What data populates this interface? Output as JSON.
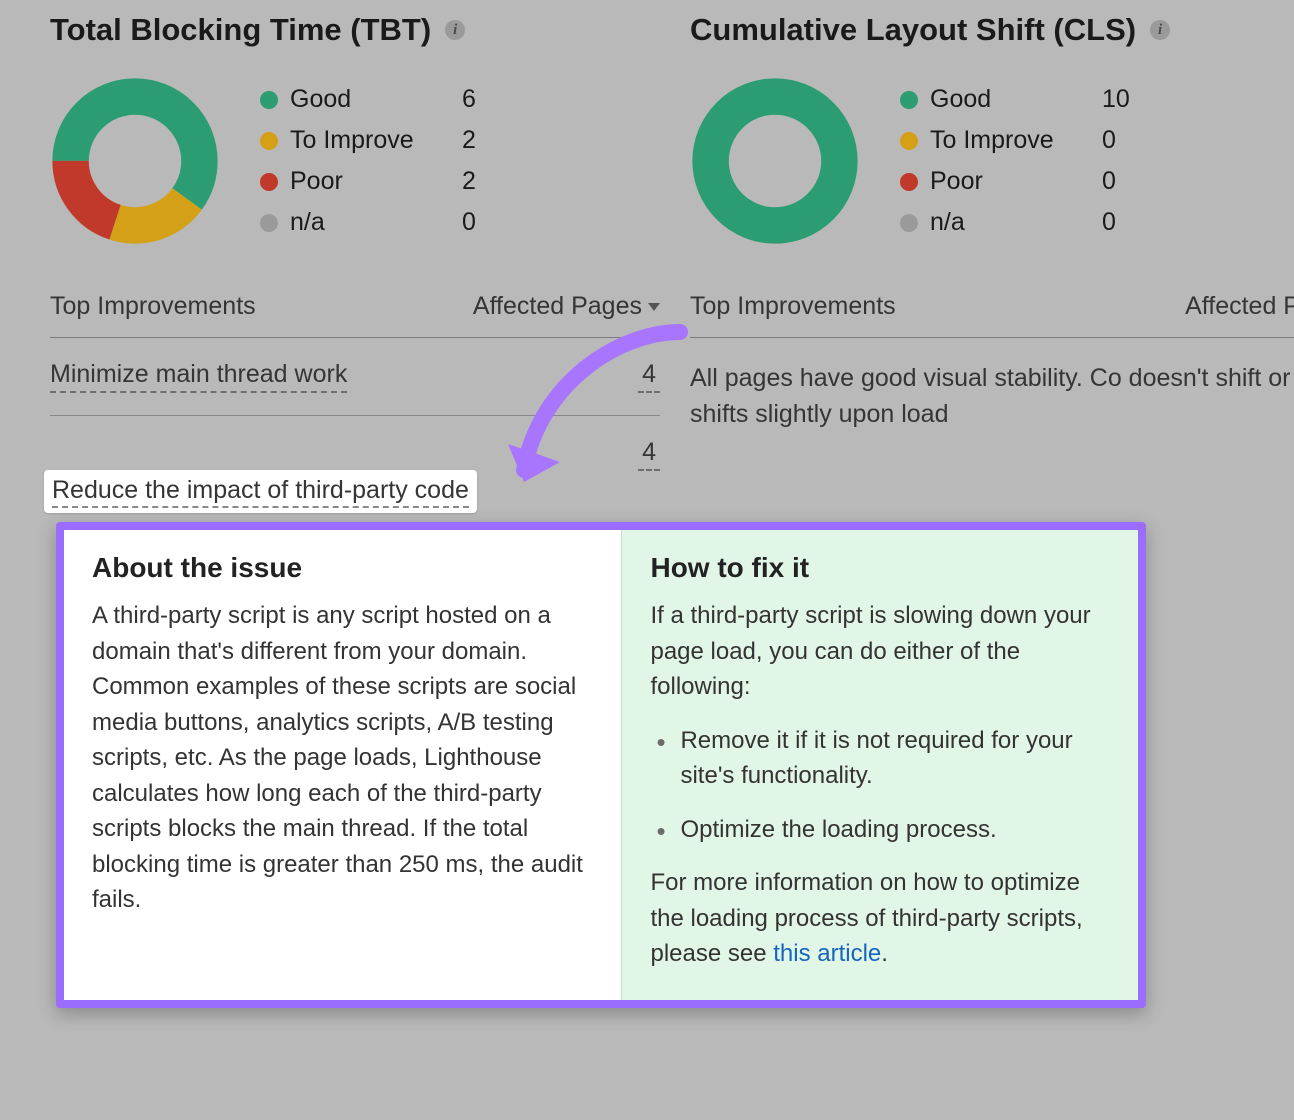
{
  "colors": {
    "good": "#2c9c72",
    "improve": "#d4a017",
    "poor": "#c0392b",
    "na": "#9a9a9a",
    "accent": "#9b6dff",
    "link": "#1565c0",
    "fix_bg": "#e2f6e7"
  },
  "metrics": {
    "tbt": {
      "title": "Total Blocking Time (TBT)",
      "legend": [
        {
          "label": "Good",
          "value": 6,
          "color": "good"
        },
        {
          "label": "To Improve",
          "value": 2,
          "color": "improve"
        },
        {
          "label": "Poor",
          "value": 2,
          "color": "poor"
        },
        {
          "label": "n/a",
          "value": 0,
          "color": "na"
        }
      ],
      "improvements": {
        "header": {
          "label": "Top Improvements",
          "count_label": "Affected Pages"
        },
        "rows": [
          {
            "label": "Minimize main thread work",
            "count": 4
          },
          {
            "label": "Reduce the impact of third-party code",
            "count": 4
          }
        ]
      }
    },
    "cls": {
      "title": "Cumulative Layout Shift (CLS)",
      "legend": [
        {
          "label": "Good",
          "value": 10,
          "color": "good"
        },
        {
          "label": "To Improve",
          "value": 0,
          "color": "improve"
        },
        {
          "label": "Poor",
          "value": 0,
          "color": "poor"
        },
        {
          "label": "n/a",
          "value": 0,
          "color": "na"
        }
      ],
      "improvements": {
        "header": {
          "label": "Top Improvements",
          "count_label": "Affected P"
        },
        "good_text": "All pages have good visual stability. Co doesn't shift or shifts slightly upon load"
      }
    }
  },
  "callout": {
    "about": {
      "heading": "About the issue",
      "body": "A third-party script is any script hosted on a domain that's different from your domain. Common examples of these scripts are social media buttons, analytics scripts, A/B testing scripts, etc. As the page loads, Lighthouse calculates how long each of the third-party scripts blocks the main thread. If the total blocking time is greater than 250 ms, the audit fails."
    },
    "fix": {
      "heading": "How to fix it",
      "intro": "If a third-party script is slowing down your page load, you can do either of the following:",
      "bullets": [
        "Remove it if it is not required for your site's functionality.",
        "Optimize the loading process."
      ],
      "more_prefix": "For more information on how to optimize the loading process of third-party scripts, please see ",
      "link_text": "this article",
      "more_suffix": "."
    }
  },
  "chart_data": [
    {
      "type": "pie",
      "title": "Total Blocking Time (TBT)",
      "categories": [
        "Good",
        "To Improve",
        "Poor",
        "n/a"
      ],
      "values": [
        6,
        2,
        2,
        0
      ]
    },
    {
      "type": "pie",
      "title": "Cumulative Layout Shift (CLS)",
      "categories": [
        "Good",
        "To Improve",
        "Poor",
        "n/a"
      ],
      "values": [
        10,
        0,
        0,
        0
      ]
    }
  ]
}
